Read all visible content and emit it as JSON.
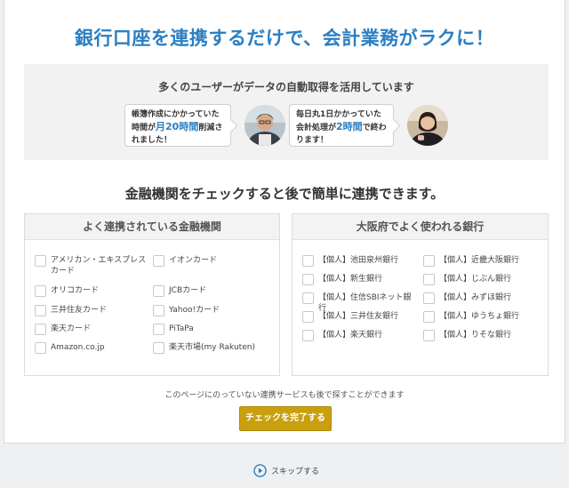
{
  "headline": "銀行口座を連携するだけで、会計業務がラクに！",
  "users": {
    "title": "多くのユーザーがデータの自動取得を活用しています",
    "testimonial1": {
      "pre": "帳簿作成にかかっていた時間が",
      "highlight": "月20時間",
      "post": "削減されました！"
    },
    "testimonial2": {
      "pre": "毎日丸1日かかっていた会計処理が",
      "highlight": "2時間",
      "post": "で終わります！"
    }
  },
  "section_title": "金融機関をチェックすると後で簡単に連携できます。",
  "popular_panel": {
    "title": "よく連携されている金融機関",
    "left_column": [
      "アメリカン・エキスプレスカード",
      "オリコカード",
      "三井住友カード",
      "楽天カード",
      "Amazon.co.jp"
    ],
    "right_column": [
      "イオンカード",
      "JCBカード",
      "Yahoo!カード",
      "PiTaPa",
      "楽天市場(my Rakuten)"
    ]
  },
  "osaka_panel": {
    "title": "大阪府でよく使われる銀行",
    "left_column": [
      "【個人】池田泉州銀行",
      "【個人】新生銀行",
      "【個人】住信SBIネット銀行",
      "【個人】三井住友銀行",
      "【個人】楽天銀行"
    ],
    "right_column": [
      "【個人】近畿大阪銀行",
      "【個人】じぶん銀行",
      "【個人】みずほ銀行",
      "【個人】ゆうちょ銀行",
      "【個人】りそな銀行"
    ]
  },
  "note": "このページにのっていない連携サービスも後で探すことができます",
  "complete_button": "チェックを完了する",
  "skip_label": "スキップする",
  "colors": {
    "accent_blue": "#2b7fc3",
    "button_gold": "#c8a00f"
  },
  "icons": {
    "skip": "play-circle-icon"
  }
}
